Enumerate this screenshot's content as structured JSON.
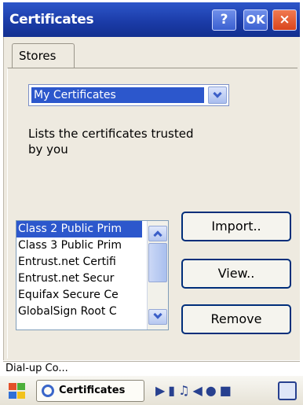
{
  "window": {
    "title": "Certificates",
    "help_label": "?",
    "ok_label": "OK",
    "close_label": "×"
  },
  "tabs": [
    {
      "label": "Stores",
      "selected": true
    }
  ],
  "store_select": {
    "value": "My Certificates"
  },
  "description": "Lists the certificates trusted by you",
  "certificates": [
    "Class 2 Public Prim",
    "Class 3 Public Prim",
    "Entrust.net Certifi",
    "Entrust.net Secur",
    "Equifax Secure Ce",
    "GlobalSign Root C"
  ],
  "buttons": {
    "import": "Import..",
    "view": "View..",
    "remove": "Remove"
  },
  "notification": "Dial-up Co...",
  "taskbar": {
    "active_app": "Certificates"
  },
  "colors": {
    "titlebar": "#1a3aa6",
    "selection": "#2c57cc",
    "close": "#d9451d"
  }
}
